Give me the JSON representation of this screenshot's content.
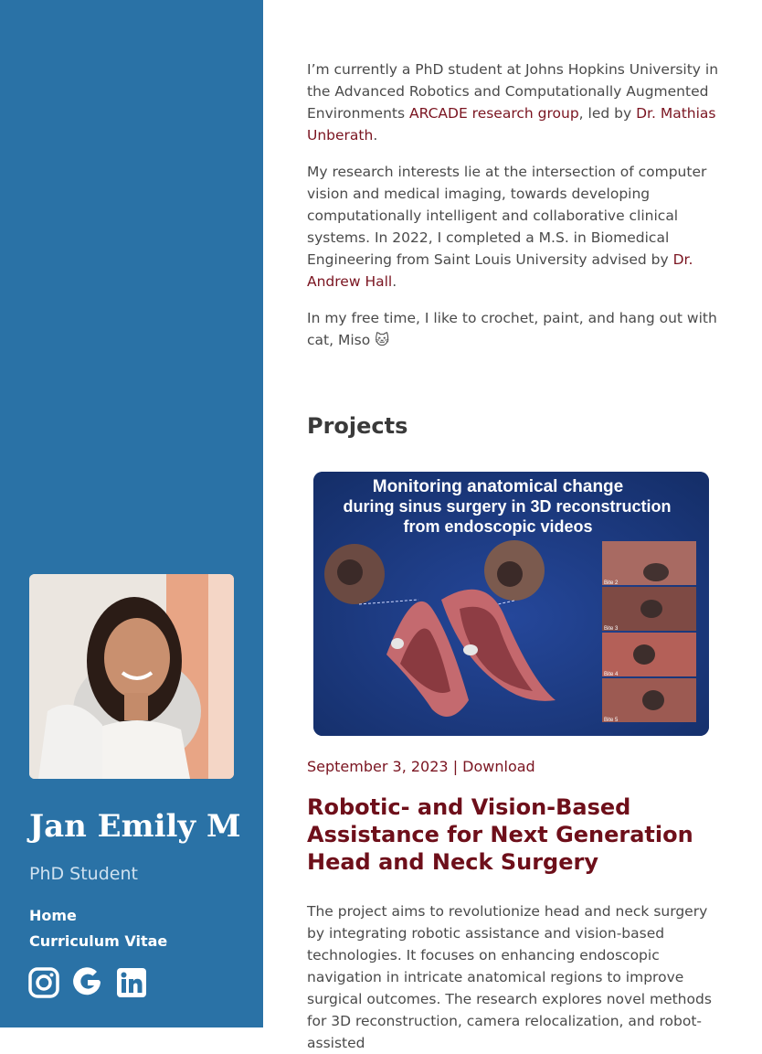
{
  "sidebar": {
    "name": "Jan Emily M",
    "role": "PhD Student",
    "nav": [
      {
        "label": "Home"
      },
      {
        "label": "Curriculum Vitae"
      }
    ],
    "social_icons": [
      "instagram-icon",
      "google-icon",
      "linkedin-icon"
    ],
    "background_color": "#2a72a6"
  },
  "about": {
    "p1_a": "I’m currently a PhD student at Johns Hopkins University in the Advanced Robotics and Computationally Augmented Environments ",
    "p1_link1": "ARCADE research group",
    "p1_b": ", led by ",
    "p1_link2": "Dr. Mathias Unberath",
    "p1_c": ".",
    "p2_a": "My research interests lie at the intersection of computer vision and medical imaging, towards developing computationally intelligent and collaborative clinical systems. In 2022, I completed a M.S. in Biomedical Engineering from Saint Louis University advised by ",
    "p2_link": "Dr. Andrew Hall",
    "p2_b": ".",
    "p3": "In my free time, I like to crochet, paint, and hang out with cat, Miso 🐱"
  },
  "projects": {
    "heading": "Projects",
    "items": [
      {
        "image_title_line1": "Monitoring anatomical change",
        "image_title_line2": "during sinus surgery in 3D reconstruction",
        "image_title_line3": "from endoscopic videos",
        "bite_labels": [
          "Bite 2",
          "Bite 3",
          "Bite 4",
          "Bite 5"
        ],
        "date": "September 3, 2023",
        "separator": "|",
        "download_label": "Download",
        "title": "Robotic- and Vision-Based Assistance for Next Generation Head and Neck Surgery",
        "description": "The project aims to revolutionize head and neck surgery by integrating robotic assistance and vision-based technologies. It focuses on enhancing endoscopic navigation in intricate anatomical regions to improve surgical outcomes. The research explores novel methods for 3D reconstruction, camera relocalization, and robot-assisted"
      }
    ]
  },
  "colors": {
    "accent": "#7a1420",
    "title": "#6e0f1a"
  }
}
